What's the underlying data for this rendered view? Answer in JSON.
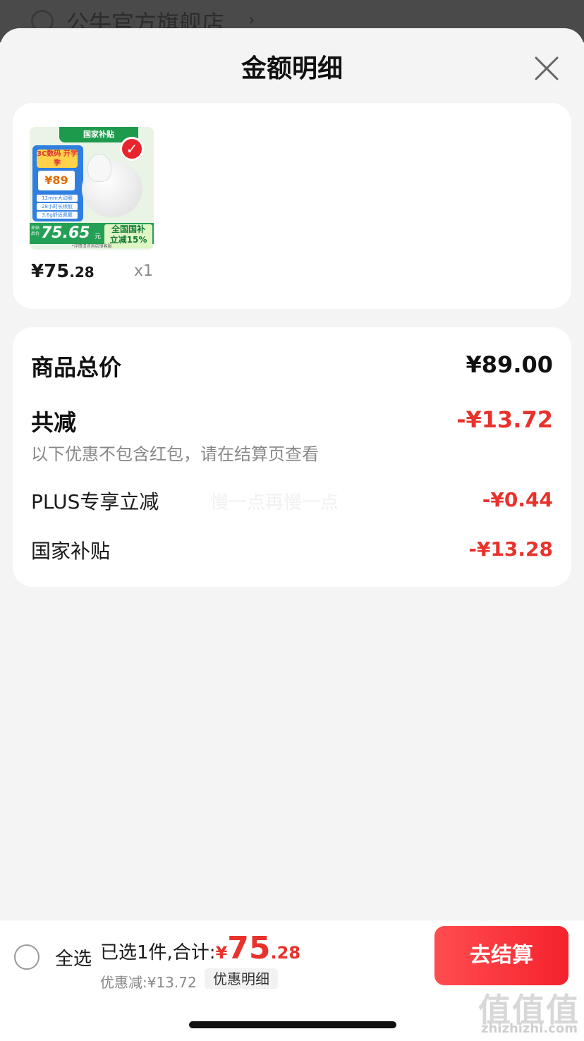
{
  "background": {
    "store_name": "公牛官方旗舰店",
    "chevron": "›"
  },
  "sheet": {
    "title": "金额明细"
  },
  "product": {
    "image": {
      "badge": "国家补贴",
      "tag": "3C数码 开学季",
      "price": "¥89",
      "features": [
        "12mm大动圈",
        "28小时长续航",
        "3.6g舒适佩戴"
      ],
      "subsidy_price": "75.65",
      "subsidy_unit": "元",
      "subsidy_side": "补贴后价",
      "subsidy_label_1": "全国国补",
      "subsidy_label_2": "立减15%",
      "footnote": "*详情请咨询店铺客服"
    },
    "price_main": "¥75",
    "price_decimal": ".28",
    "quantity": "x1",
    "selected": true
  },
  "summary": {
    "total_label": "商品总价",
    "total_value": "¥89.00",
    "reduce_label": "共减",
    "reduce_value": "-¥13.72",
    "note": "以下优惠不包含红包，请在结算页查看",
    "items": [
      {
        "label": "PLUS专享立减",
        "value": "-¥0.44"
      },
      {
        "label": "国家补贴",
        "value": "-¥13.28"
      }
    ],
    "watermark": "慢一点再慢一点"
  },
  "bottom_bar": {
    "select_all": "全选",
    "selected_text": "已选1件,合计:",
    "total_currency": "¥",
    "total_int": "75",
    "total_dec": ".28",
    "discount_text": "优惠减:¥13.72",
    "discount_detail": "优惠明细",
    "checkout_label": "去结算"
  },
  "corner_watermark": {
    "glyphs": "值值值",
    "url": "zhizhizhi.com"
  },
  "colors": {
    "accent_red": "#e8322b",
    "checkout_red": "#f5222d",
    "background": "#f4f4f4"
  }
}
